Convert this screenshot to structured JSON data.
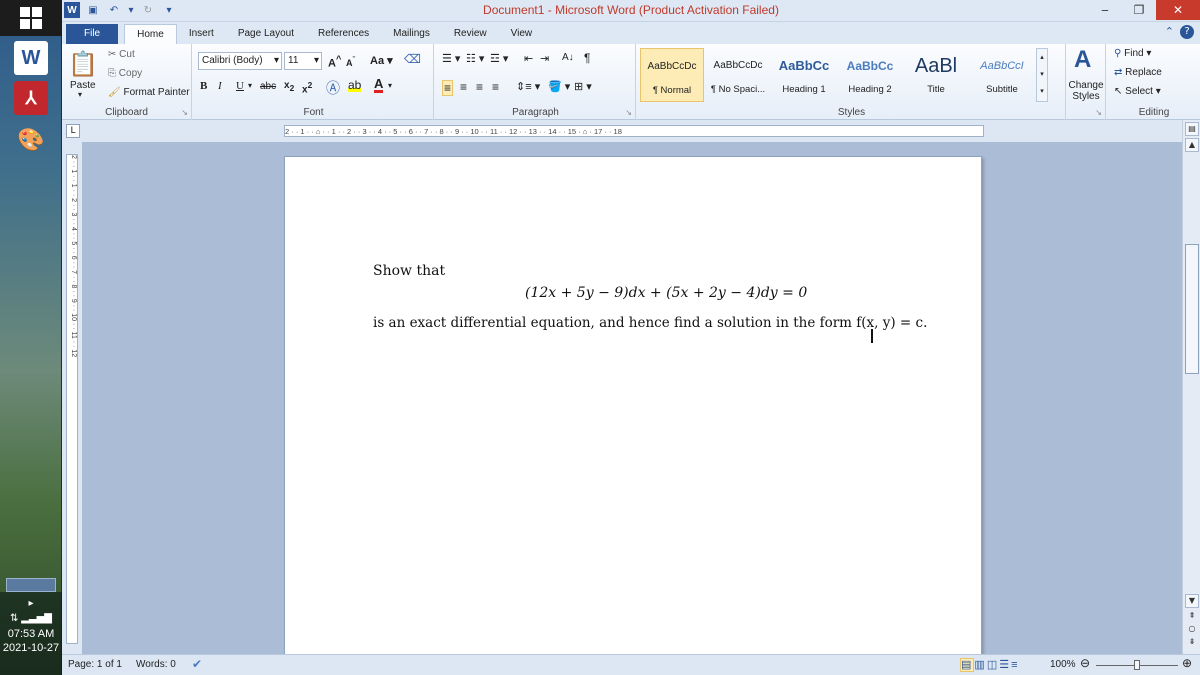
{
  "taskbar": {
    "clock_time": "07:53 AM",
    "clock_date": "2021-10-27",
    "apps": [
      {
        "name": "word-app-icon",
        "glyph": "W"
      },
      {
        "name": "acrobat-app-icon",
        "glyph": "⅄"
      },
      {
        "name": "paint-app-icon",
        "glyph": "🎨"
      }
    ]
  },
  "titlebar": {
    "title": "Document1 - Microsoft Word (Product Activation Failed)",
    "title_color": "#c0392b"
  },
  "tabs": [
    "File",
    "Home",
    "Insert",
    "Page Layout",
    "References",
    "Mailings",
    "Review",
    "View"
  ],
  "active_tab": "Home",
  "clipboard": {
    "paste": "Paste",
    "cut": "Cut",
    "copy": "Copy",
    "format_painter": "Format Painter",
    "label": "Clipboard"
  },
  "font": {
    "family": "Calibri (Body)",
    "size": "11",
    "grow": "A",
    "shrink": "A",
    "change_case": "Aa",
    "bold": "B",
    "italic": "I",
    "underline": "U",
    "strike": "abc",
    "subscript": "x",
    "superscript": "x",
    "label": "Font"
  },
  "paragraph": {
    "label": "Paragraph",
    "sort": "A↓",
    "pilcrow": "¶"
  },
  "styles": {
    "items": [
      {
        "preview": "AaBbCcDc",
        "name": "¶ Normal"
      },
      {
        "preview": "AaBbCcDc",
        "name": "¶ No Spaci..."
      },
      {
        "preview": "AaBbCc",
        "name": "Heading 1"
      },
      {
        "preview": "AaBbCc",
        "name": "Heading 2"
      },
      {
        "preview": "AaBl",
        "name": "Title"
      },
      {
        "preview": "AaBbCcI",
        "name": "Subtitle"
      }
    ],
    "change_styles": "Change Styles",
    "label": "Styles"
  },
  "editing": {
    "find": "Find",
    "replace": "Replace",
    "select": "Select",
    "label": "Editing"
  },
  "ruler": {
    "horizontal": "2 · · 1 · · ⌂ · · 1 · · 2 · · 3 · · 4 · · 5 · · 6 · · 7 · · 8 · · 9 · · 10 · · 11 · · 12 · · 13 · · 14 · · 15 · ⌂ · 17 · · 18",
    "vertical": "2 · · 1 · · 1 · · 2 · · 3 · · 4 · · 5 · · 6 · · 7 · · 8 · · 9 · · 10 · · 11 · · 12",
    "tab_selector": "L"
  },
  "document": {
    "line1": "Show that",
    "equation": "(12x + 5y − 9)dx + (5x + 2y − 4)dy = 0",
    "line3": "is an exact differential equation, and hence find a solution in the form f(x, y) = c."
  },
  "statusbar": {
    "page": "Page: 1 of 1",
    "words": "Words: 0",
    "zoom": "100%"
  }
}
